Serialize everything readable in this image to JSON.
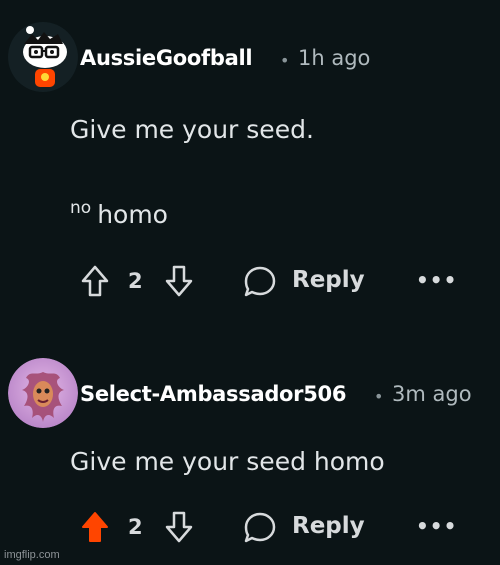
{
  "comments": [
    {
      "username": "AussieGoofball",
      "separator": "•",
      "time": "1h ago",
      "body_line1": "Give me your seed.",
      "body_line2_sup": "no",
      "body_line2": "homo",
      "upvotes": "2",
      "upvoted": false,
      "reply_label": "Reply",
      "more_label": "•••"
    },
    {
      "username": "Select-Ambassador506",
      "separator": "•",
      "time": "3m ago",
      "body_line1": "Give me your seed homo",
      "upvotes": "2",
      "upvoted": true,
      "reply_label": "Reply",
      "more_label": "•••"
    }
  ],
  "colors": {
    "background": "#0b1416",
    "upvote_active": "#ff4500"
  },
  "watermark": "imgflip.com"
}
